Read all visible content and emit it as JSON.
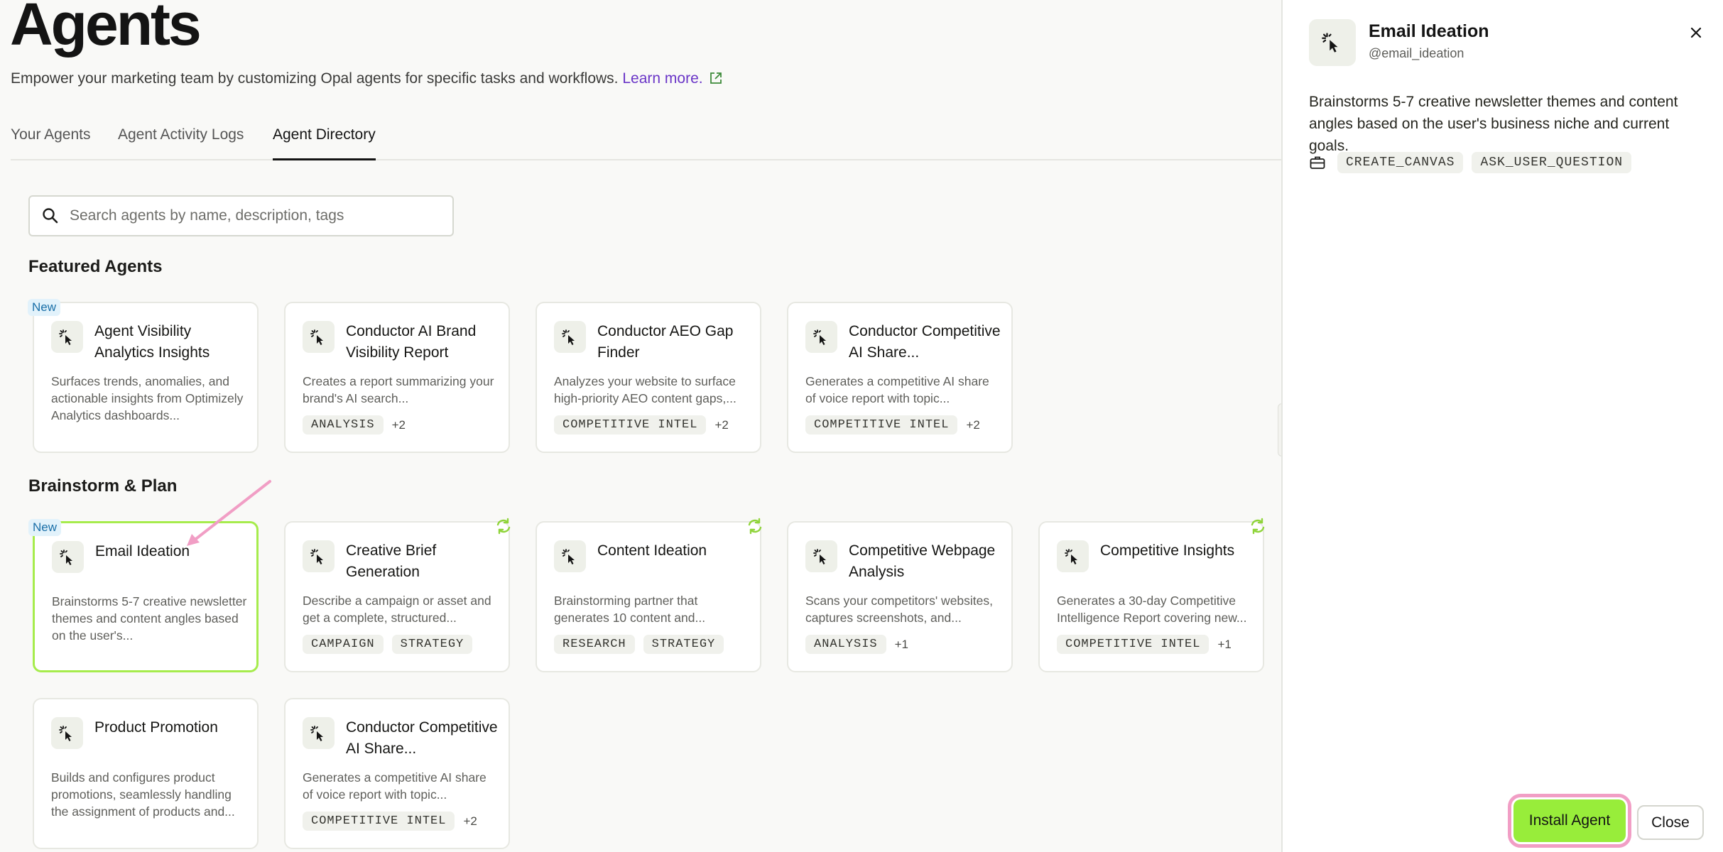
{
  "header": {
    "title": "Agents",
    "subtitle": "Empower your marketing team by customizing Opal agents for specific tasks and workflows.",
    "learn_more": "Learn more."
  },
  "tabs": [
    {
      "label": "Your Agents",
      "active": false
    },
    {
      "label": "Agent Activity Logs",
      "active": false
    },
    {
      "label": "Agent Directory",
      "active": true
    }
  ],
  "search": {
    "placeholder": "Search agents by name, description, tags",
    "value": ""
  },
  "sections": {
    "featured": {
      "title": "Featured Agents",
      "cards": [
        {
          "name": "Agent Visibility Analytics Insights",
          "desc": "Surfaces trends, anomalies, and actionable insights from Optimizely Analytics dashboards...",
          "tags": [],
          "more": "",
          "badge": "New"
        },
        {
          "name": "Conductor AI Brand Visibility Report",
          "desc": "Creates a report summarizing your brand's AI search...",
          "tags": [
            "ANALYSIS"
          ],
          "more": "+2"
        },
        {
          "name": "Conductor AEO Gap Finder",
          "desc": "Analyzes your website to surface high-priority AEO content gaps,...",
          "tags": [
            "COMPETITIVE INTEL"
          ],
          "more": "+2"
        },
        {
          "name": "Conductor Competitive AI Share...",
          "desc": "Generates a competitive AI share of voice report with topic...",
          "tags": [
            "COMPETITIVE INTEL"
          ],
          "more": "+2"
        }
      ]
    },
    "brainstorm": {
      "title": "Brainstorm & Plan",
      "cards": [
        {
          "name": "Email Ideation",
          "desc": "Brainstorms 5-7 creative newsletter themes and content angles based on the user's...",
          "tags": [],
          "more": "",
          "badge": "New",
          "selected": true
        },
        {
          "name": "Creative Brief Generation",
          "desc": "Describe a campaign or asset and get a complete, structured...",
          "tags": [
            "CAMPAIGN",
            "STRATEGY"
          ],
          "more": ""
        },
        {
          "name": "Content Ideation",
          "desc": "Brainstorming partner that generates 10 content and...",
          "tags": [
            "RESEARCH",
            "STRATEGY"
          ],
          "more": ""
        },
        {
          "name": "Competitive Webpage Analysis",
          "desc": "Scans your competitors' websites, captures screenshots, and...",
          "tags": [
            "ANALYSIS"
          ],
          "more": "+1"
        },
        {
          "name": "Competitive Insights",
          "desc": "Generates a 30-day Competitive Intelligence Report covering new...",
          "tags": [
            "COMPETITIVE INTEL"
          ],
          "more": "+1"
        },
        {
          "name": "Product Promotion",
          "desc": "Builds and configures product promotions, seamlessly handling the assignment of products and...",
          "tags": [],
          "more": ""
        },
        {
          "name": "Conductor Competitive AI Share...",
          "desc": "Generates a competitive AI share of voice report with topic...",
          "tags": [
            "COMPETITIVE INTEL"
          ],
          "more": "+2"
        }
      ]
    }
  },
  "drawer": {
    "title": "Email Ideation",
    "handle": "@email_ideation",
    "description": "Brainstorms 5-7 creative newsletter themes and content angles based on the user's business niche and current goals.",
    "tools": [
      "CREATE_CANVAS",
      "ASK_USER_QUESTION"
    ],
    "install_label": "Install Agent",
    "close_label": "Close"
  },
  "colors": {
    "accent": "#98ed3a",
    "link": "#6a35c7",
    "highlight": "#f19ec5"
  }
}
